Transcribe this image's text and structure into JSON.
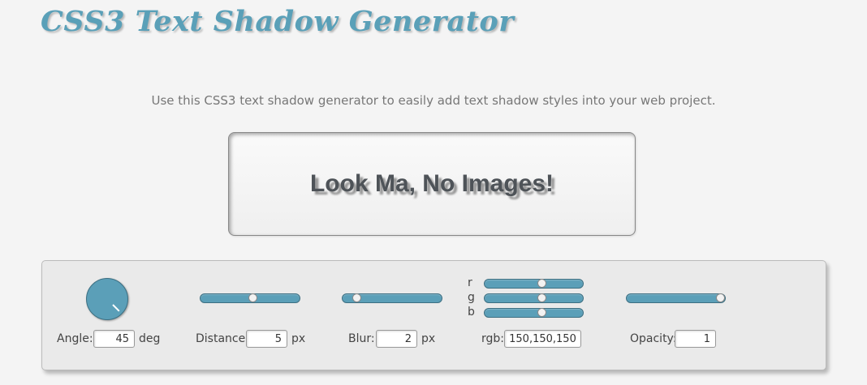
{
  "header": {
    "title": "CSS3 Text Shadow Generator",
    "description": "Use this CSS3 text shadow generator to easily add text shadow styles into your web project."
  },
  "preview": {
    "text": "Look Ma, No Images!"
  },
  "controls": {
    "angle": {
      "label": "Angle:",
      "value": "45",
      "unit": "deg",
      "icon": "angle-knob-icon"
    },
    "distance": {
      "label": "Distance:",
      "value": "5",
      "unit": "px",
      "slider_fraction": 0.53
    },
    "blur": {
      "label": "Blur:",
      "value": "2",
      "unit": "px",
      "slider_fraction": 0.1
    },
    "rgb": {
      "label": "rgb:",
      "value": "150,150,150",
      "r_label": "r",
      "g_label": "g",
      "b_label": "b",
      "r_fraction": 0.59,
      "g_fraction": 0.59,
      "b_fraction": 0.59
    },
    "opacity": {
      "label": "Opacity:",
      "value": "1",
      "slider_fraction": 1.0
    }
  },
  "colors": {
    "accent": "#5b9fb8",
    "title": "#5aa0b8",
    "preview_text": "#4e5358",
    "shadow": "#969696"
  }
}
